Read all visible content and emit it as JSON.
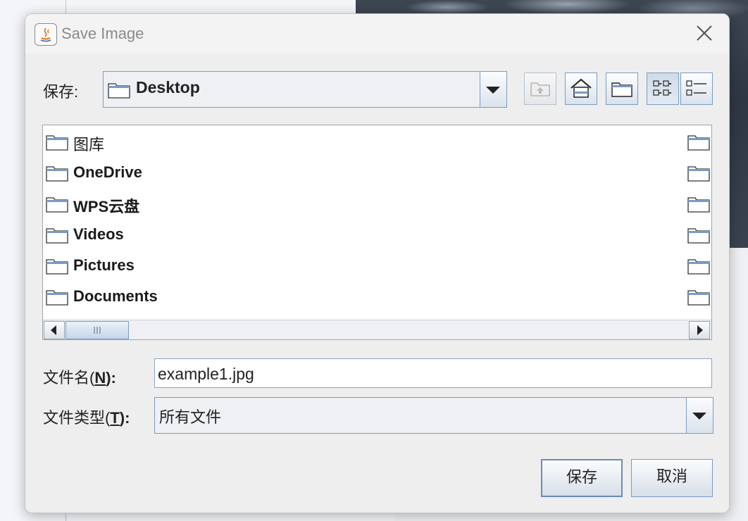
{
  "window": {
    "title": "Save Image"
  },
  "save_in": {
    "label": "保存:",
    "folder": "Desktop"
  },
  "files": [
    {
      "name": "图库",
      "bold": false
    },
    {
      "name": "OneDrive",
      "bold": true
    },
    {
      "name": "WPS云盘",
      "bold": true
    },
    {
      "name": "Videos",
      "bold": true
    },
    {
      "name": "Pictures",
      "bold": true
    },
    {
      "name": "Documents",
      "bold": true
    }
  ],
  "filename": {
    "label_prefix": "文件名(",
    "mnemonic": "N",
    "label_suffix": "):",
    "value": "example1.jpg"
  },
  "filetype": {
    "label_prefix": "文件类型(",
    "mnemonic": "T",
    "label_suffix": "):",
    "value": "所有文件"
  },
  "buttons": {
    "save": "保存",
    "cancel": "取消"
  },
  "icons": {
    "app": "java-icon",
    "close": "close-icon",
    "up": "up-folder-icon",
    "home": "home-icon",
    "new_folder": "new-folder-icon",
    "list_view": "list-view-icon",
    "details_view": "details-view-icon"
  }
}
